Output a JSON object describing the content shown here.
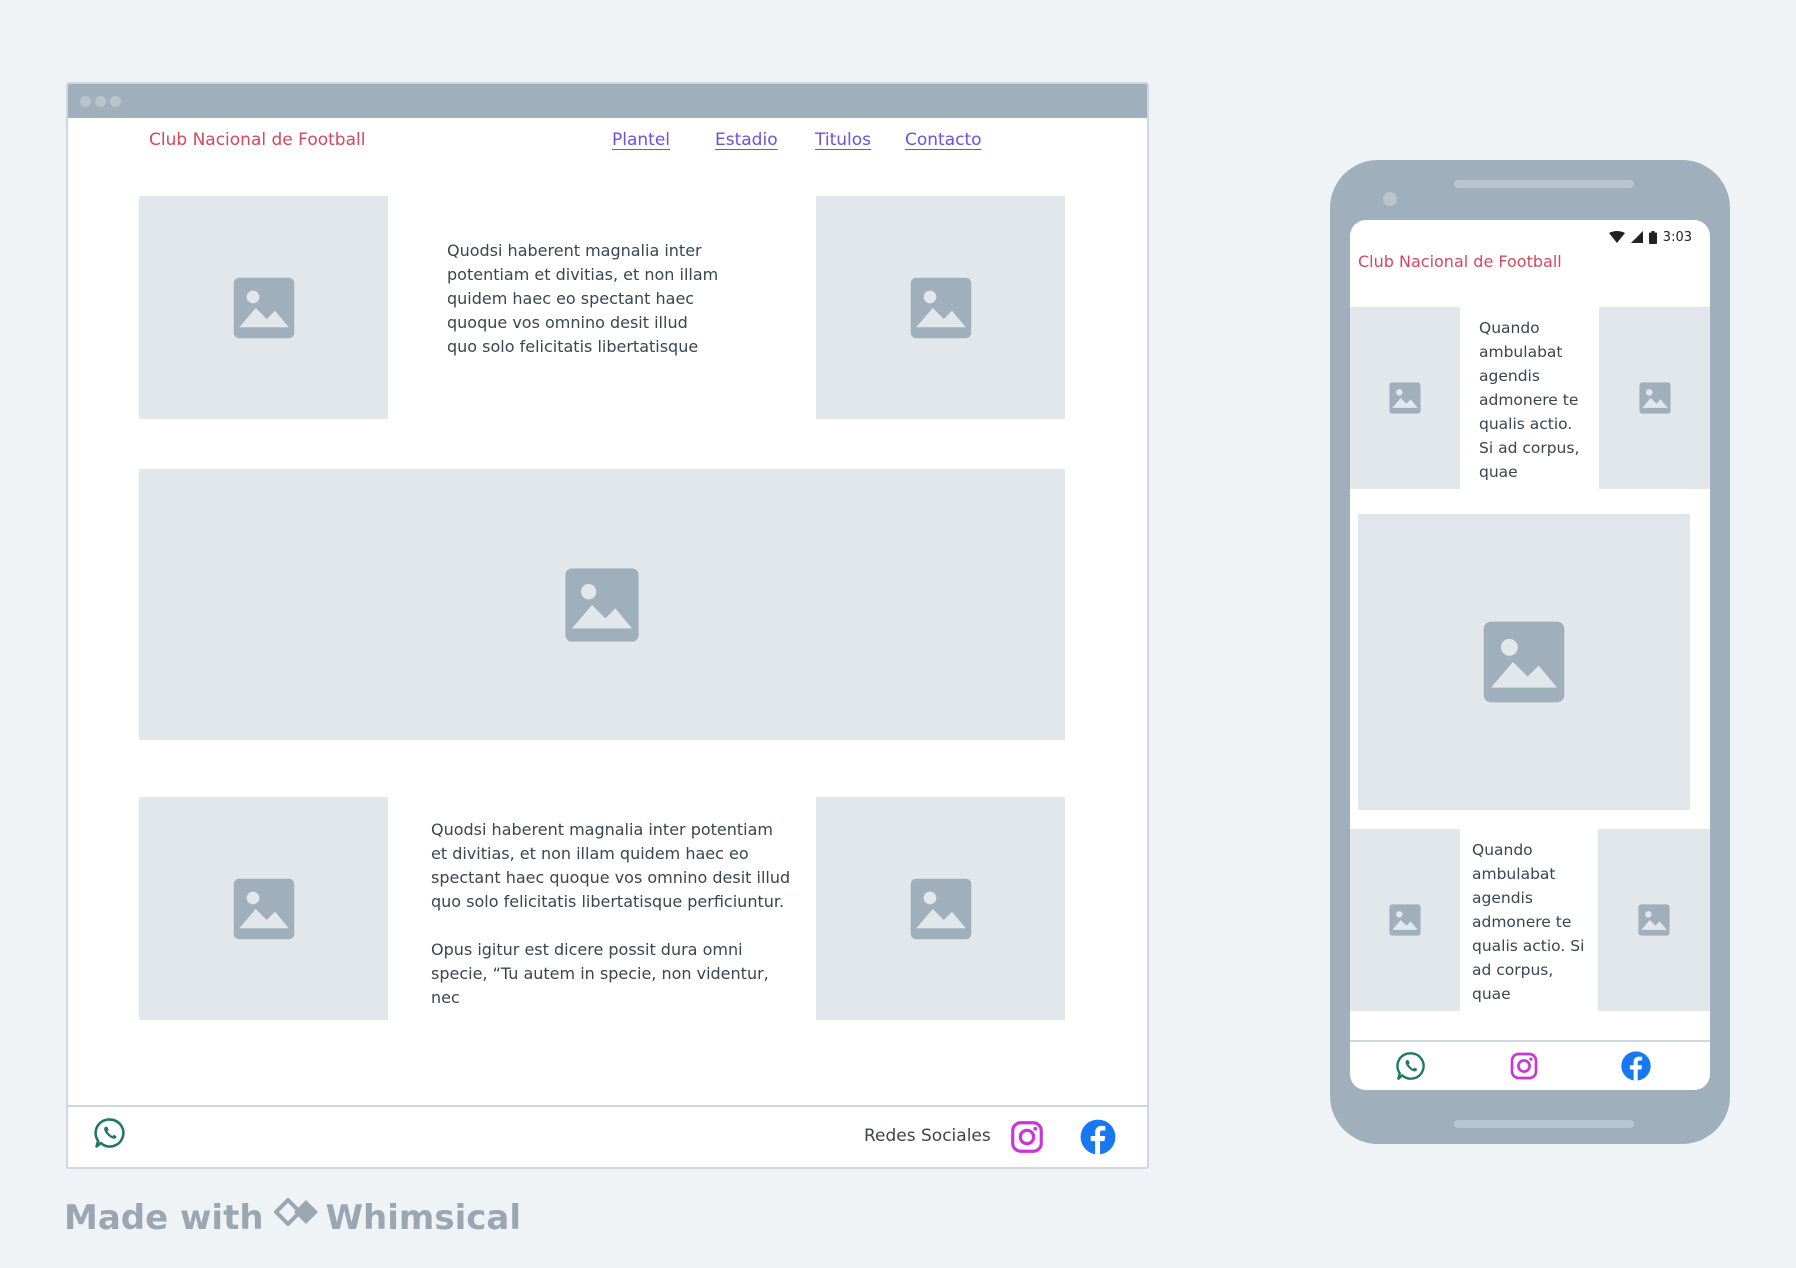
{
  "desktop": {
    "brand": "Club Nacional de Football",
    "nav": [
      "Plantel",
      "Estadio",
      "Titulos",
      "Contacto"
    ],
    "section1_text": "Quodsi haberent magnalia inter potentiam et divitias, et non illam quidem haec eo spectant haec quoque vos omnino desit illud quo solo felicitatis libertatisque",
    "section3_text_1": "Quodsi haberent magnalia inter potentiam et divitias, et non illam quidem haec eo spectant haec quoque vos omnino desit illud quo solo felicitatis libertatisque perficiuntur.",
    "section3_text_2": "Opus igitur est dicere possit dura omni specie, “Tu autem in specie, non videntur, nec",
    "footer": {
      "social_label": "Redes Sociales"
    }
  },
  "mobile": {
    "status_time": "3:03",
    "brand": "Club Nacional de Football",
    "section1_text": "Quando ambulabat agendis admonere te qualis actio. Si ad corpus, quae",
    "section3_text": "Quando ambulabat agendis admonere te qualis actio. Si ad corpus, quae"
  },
  "icons": {
    "placeholder": "image-placeholder-icon",
    "whatsapp": "whatsapp-icon",
    "instagram": "instagram-icon",
    "facebook": "facebook-icon"
  },
  "colors": {
    "brand": "#d6475d",
    "nav_link": "#6b4fe6",
    "whatsapp": "#1f7a5c",
    "instagram": "#c837d6",
    "facebook": "#1877f2",
    "placeholder_bg": "#e2e7eb",
    "placeholder_icon": "#9fafbc"
  },
  "watermark": {
    "prefix": "Made with",
    "brand": "Whimsical"
  }
}
